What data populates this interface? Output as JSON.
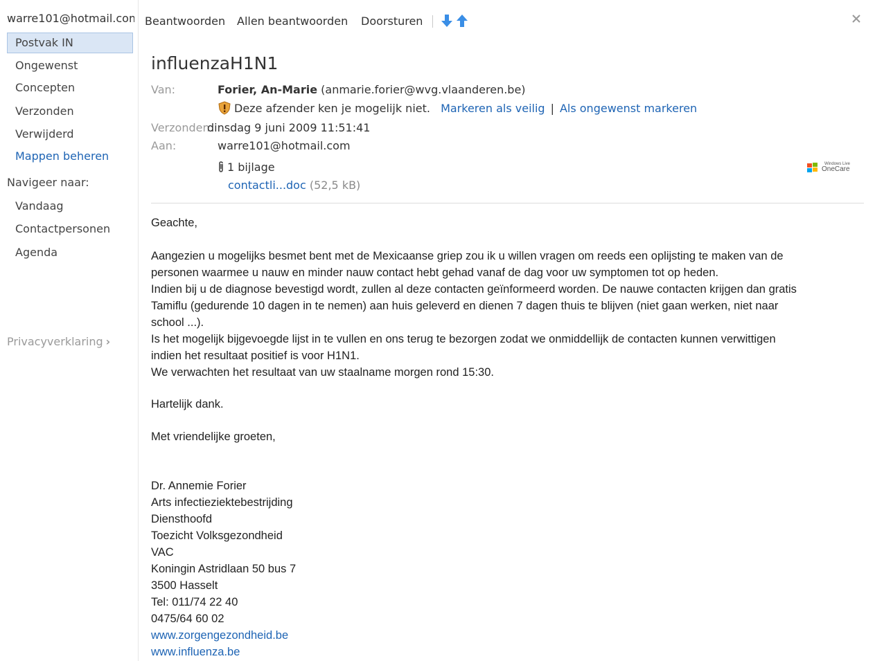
{
  "sidebar": {
    "account": "warre101@hotmail.com",
    "folders": [
      {
        "label": "Postvak IN",
        "active": true
      },
      {
        "label": "Ongewenst"
      },
      {
        "label": "Concepten"
      },
      {
        "label": "Verzonden"
      },
      {
        "label": "Verwijderd"
      }
    ],
    "manage_folders": "Mappen beheren",
    "navigate_heading": "Navigeer naar:",
    "navigate": [
      "Vandaag",
      "Contactpersonen",
      "Agenda"
    ],
    "privacy": "Privacyverklaring",
    "privacy_chevron": "›"
  },
  "toolbar": {
    "reply": "Beantwoorden",
    "reply_all": "Allen beantwoorden",
    "forward": "Doorsturen",
    "icons": [
      "arrow-down-icon",
      "arrow-up-icon",
      "close-icon"
    ]
  },
  "message": {
    "subject": "influenzaH1N1",
    "from_label": "Van:",
    "from_name": "Forier, An-Marie",
    "from_email": "(anmarie.forier@wvg.vlaanderen.be)",
    "warning": "Deze afzender ken je mogelijk niet.",
    "mark_safe": "Markeren als veilig",
    "separator": "|",
    "mark_junk": "Als ongewenst markeren",
    "sent_label": "Verzonden:",
    "sent_value": "dinsdag 9 juni 2009 11:51:41",
    "to_label": "Aan:",
    "to_value": "warre101@hotmail.com",
    "attachments_count": "1 bijlage",
    "attachment_name": "contactli...doc",
    "attachment_size": "(52,5 kB)",
    "onecare_badge_top": "Windows Live",
    "onecare_badge_bottom": "OneCare"
  },
  "body": {
    "greeting": "Geachte,",
    "paragraph": [
      "Aangezien u mogelijks besmet bent met de Mexicaanse griep zou ik u willen vragen om reeds een oplijsting te maken van de",
      "personen waarmee u nauw en minder nauw contact hebt gehad vanaf de dag voor uw symptomen tot op heden.",
      "Indien bij u de diagnose bevestigd wordt, zullen al deze contacten geïnformeerd worden. De nauwe contacten krijgen dan gratis",
      "Tamiflu (gedurende 10 dagen in te nemen) aan huis geleverd en dienen 7 dagen thuis te blijven (niet gaan werken, niet naar",
      "school ...).",
      "Is het mogelijk bijgevoegde lijst in te vullen en ons terug te bezorgen zodat we onmiddellijk de contacten kunnen verwittigen",
      "indien het resultaat positief is voor H1N1.",
      "We verwachten het resultaat van uw staalname morgen rond 15:30."
    ],
    "thanks": "Hartelijk dank.",
    "closing": "Met vriendelijke groeten,",
    "signature": [
      "Dr. Annemie Forier",
      "Arts infectieziektebestrijding",
      "Diensthoofd",
      "Toezicht Volksgezondheid",
      "VAC",
      "Koningin Astridlaan 50 bus 7",
      "3500 Hasselt",
      "Tel: 011/74 22 40",
      "0475/64 60 02"
    ],
    "links": [
      "www.zorgengezondheid.be",
      "www.influenza.be"
    ]
  },
  "colors": {
    "link": "#1e64b4",
    "active_folder_bg": "#dae6f5",
    "arrow": "#3a8ee6"
  }
}
